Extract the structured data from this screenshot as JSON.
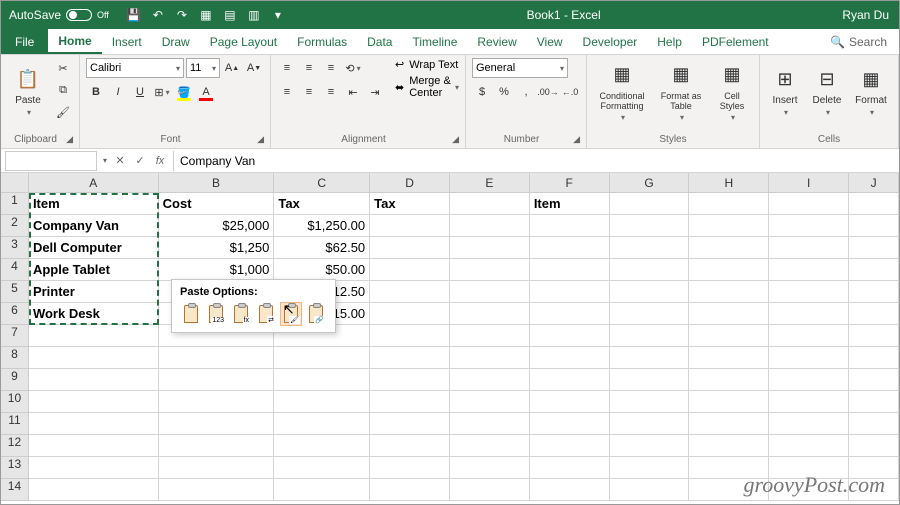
{
  "titlebar": {
    "autosave_label": "AutoSave",
    "autosave_state": "Off",
    "title": "Book1 - Excel",
    "user": "Ryan Du"
  },
  "menu": {
    "file": "File",
    "home": "Home",
    "insert": "Insert",
    "draw": "Draw",
    "page_layout": "Page Layout",
    "formulas": "Formulas",
    "data": "Data",
    "timeline": "Timeline",
    "review": "Review",
    "view": "View",
    "developer": "Developer",
    "help": "Help",
    "pdfelement": "PDFelement",
    "search": "Search"
  },
  "ribbon": {
    "clipboard": {
      "label": "Clipboard",
      "paste": "Paste"
    },
    "font": {
      "label": "Font",
      "name": "Calibri",
      "size": "11",
      "bold": "B",
      "italic": "I",
      "underline": "U"
    },
    "alignment": {
      "label": "Alignment",
      "wrap": "Wrap Text",
      "merge": "Merge & Center"
    },
    "number": {
      "label": "Number",
      "format": "General",
      "currency": "$",
      "percent": "%",
      "comma": ","
    },
    "styles": {
      "label": "Styles",
      "conditional": "Conditional Formatting",
      "format_as_table": "Format as Table",
      "cell_styles": "Cell Styles"
    },
    "cells": {
      "label": "Cells",
      "insert": "Insert",
      "delete": "Delete",
      "format": "Format"
    }
  },
  "formula_bar": {
    "name_box": "",
    "fx": "fx",
    "value": "Company Van"
  },
  "columns": [
    "A",
    "B",
    "C",
    "D",
    "E",
    "F",
    "G",
    "H",
    "I",
    "J"
  ],
  "headers": {
    "item": "Item",
    "cost": "Cost",
    "tax": "Tax",
    "tax2": "Tax",
    "item2": "Item"
  },
  "rows": [
    {
      "item": "Company Van",
      "cost": "$25,000",
      "tax": "$1,250.00"
    },
    {
      "item": "Dell Computer",
      "cost": "$1,250",
      "tax": "$62.50"
    },
    {
      "item": "Apple Tablet",
      "cost": "$1,000",
      "tax": "$50.00"
    },
    {
      "item": "Printer",
      "cost": "",
      "tax": "$12.50"
    },
    {
      "item": "Work Desk",
      "cost": "",
      "tax": "$15.00"
    }
  ],
  "paste_popup": {
    "title": "Paste Options:"
  },
  "watermark": "groovyPost.com"
}
